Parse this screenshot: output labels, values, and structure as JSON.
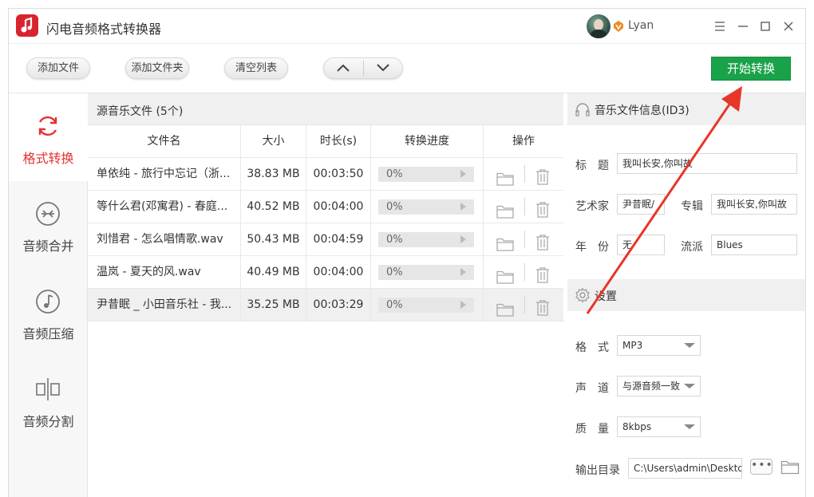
{
  "app": {
    "title": "闪电音频格式转换器"
  },
  "user": {
    "name": "Lyan"
  },
  "toolbar": {
    "add_file": "添加文件",
    "add_folder": "添加文件夹",
    "clear_list": "清空列表",
    "start": "开始转换"
  },
  "sidebar": {
    "items": [
      {
        "label": "格式转换",
        "icon": "refresh-icon",
        "active": true
      },
      {
        "label": "音频合并",
        "icon": "merge-icon",
        "active": false
      },
      {
        "label": "音频压缩",
        "icon": "music-note-icon",
        "active": false
      },
      {
        "label": "音频分割",
        "icon": "split-icon",
        "active": false
      }
    ]
  },
  "list": {
    "title": "源音乐文件 (5个)",
    "columns": {
      "name": "文件名",
      "size": "大小",
      "duration": "时长(s)",
      "progress": "转换进度",
      "ops": "操作"
    },
    "rows": [
      {
        "name": "单依纯 - 旅行中忘记（浙...",
        "size": "38.83 MB",
        "duration": "00:03:50",
        "progress": "0%"
      },
      {
        "name": "等什么君(邓寓君) - 春庭...",
        "size": "40.52 MB",
        "duration": "00:04:00",
        "progress": "0%"
      },
      {
        "name": "刘惜君 - 怎么唱情歌.wav",
        "size": "50.43 MB",
        "duration": "00:04:59",
        "progress": "0%"
      },
      {
        "name": "温岚 - 夏天的风.wav",
        "size": "40.49 MB",
        "duration": "00:04:00",
        "progress": "0%"
      },
      {
        "name": "尹昔眠 _ 小田音乐社 - 我...",
        "size": "35.25 MB",
        "duration": "00:03:29",
        "progress": "0%"
      }
    ]
  },
  "info": {
    "heading": "音乐文件信息(ID3)",
    "title_label": "标　题",
    "title_value": "我叫长安,你叫故",
    "artist_label": "艺术家",
    "artist_value": "尹昔眠/",
    "album_label": "专辑",
    "album_value": "我叫长安,你叫故",
    "year_label": "年　份",
    "year_value": "无",
    "genre_label": "流派",
    "genre_value": "Blues"
  },
  "settings": {
    "heading": "设置",
    "format_label": "格　式",
    "format_value": "MP3",
    "channel_label": "声　道",
    "channel_value": "与源音频一致",
    "quality_label": "质　量",
    "quality_value": "8kbps",
    "output_label": "输出目录",
    "output_value": "C:\\Users\\admin\\Desktc",
    "more_label": "•••"
  },
  "colors": {
    "brand_red": "#d9232f",
    "start_green": "#1aa24a",
    "arrow_red": "#e8352a"
  }
}
